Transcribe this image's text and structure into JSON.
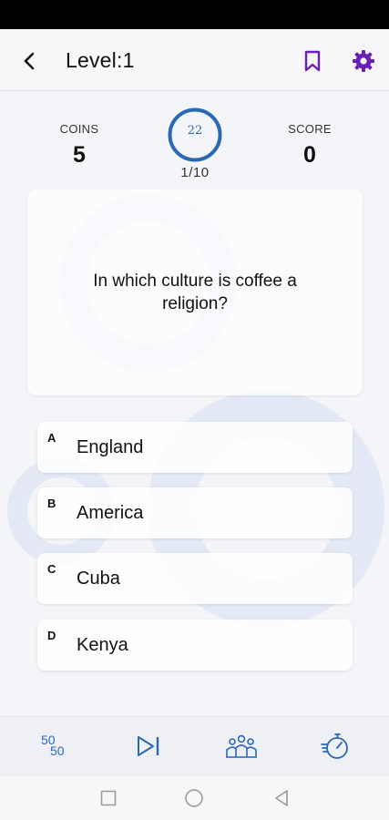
{
  "header": {
    "title": "Level:1",
    "back_icon": "arrow-left-icon",
    "bookmark_icon": "bookmark-icon",
    "settings_icon": "gear-icon"
  },
  "stats": {
    "coins_label": "COINS",
    "coins_value": "5",
    "score_label": "SCORE",
    "score_value": "0",
    "timer_value": "22",
    "progress": "1/10"
  },
  "question": {
    "text": "In which culture is coffee a religion?"
  },
  "options": [
    {
      "letter": "A",
      "text": "England"
    },
    {
      "letter": "B",
      "text": "America"
    },
    {
      "letter": "C",
      "text": "Cuba"
    },
    {
      "letter": "D",
      "text": "Kenya"
    }
  ],
  "lifelines": {
    "fifty_fifty": {
      "label_top": "50",
      "label_bottom": "50",
      "icon": "fifty-fifty-icon"
    },
    "skip": {
      "icon": "skip-next-icon"
    },
    "audience": {
      "icon": "audience-poll-icon"
    },
    "time": {
      "icon": "stopwatch-icon"
    }
  },
  "colors": {
    "accent_purple": "#6a1fb8",
    "accent_blue": "#2a69b2",
    "ring": "#e3eaf6",
    "background": "#f4f5f8"
  },
  "system_nav": {
    "recent_icon": "square-icon",
    "home_icon": "circle-icon",
    "back_icon": "triangle-back-icon"
  }
}
